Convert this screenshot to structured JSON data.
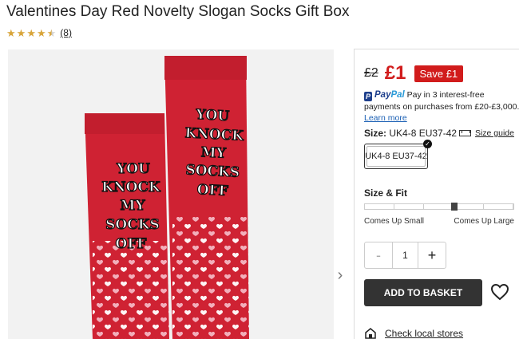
{
  "product": {
    "title": "Valentines Day Red Novelty Slogan Socks Gift Box",
    "rating": 4.5,
    "review_count": "(8)",
    "image_slogan": [
      "YOU",
      "KNOCK",
      "MY",
      "SOCKS",
      "OFF"
    ]
  },
  "icons": {
    "star": "star-icon",
    "next": "chevron-right-icon",
    "ruler": "ruler-icon",
    "heart": "heart-icon",
    "store": "store-icon",
    "check": "check-icon"
  },
  "colors": {
    "sale_red": "#d11c1c",
    "sock_red": "#cf2233",
    "star_gold": "#d8a53a",
    "button_dark": "#333333"
  },
  "pricing": {
    "old_price": "£2",
    "new_price": "£1",
    "save_label": "Save £1"
  },
  "paypal": {
    "logo_pay": "Pay",
    "logo_pal": "Pal",
    "text": "Pay in 3 interest-free payments on purchases from £20-£3,000.",
    "learn_more": "Learn more"
  },
  "size": {
    "label": "Size:",
    "selected": "UK4-8 EU37-42",
    "guide_label": "Size guide",
    "options": [
      "UK4-8 EU37-42"
    ]
  },
  "fit": {
    "title": "Size & Fit",
    "left_label": "Comes Up Small",
    "right_label": "Comes Up Large",
    "position": 0.6
  },
  "quantity": {
    "minus": "-",
    "value": "1",
    "plus": "+"
  },
  "actions": {
    "add_to_basket": "ADD TO BASKET",
    "check_local": "Check local stores"
  }
}
